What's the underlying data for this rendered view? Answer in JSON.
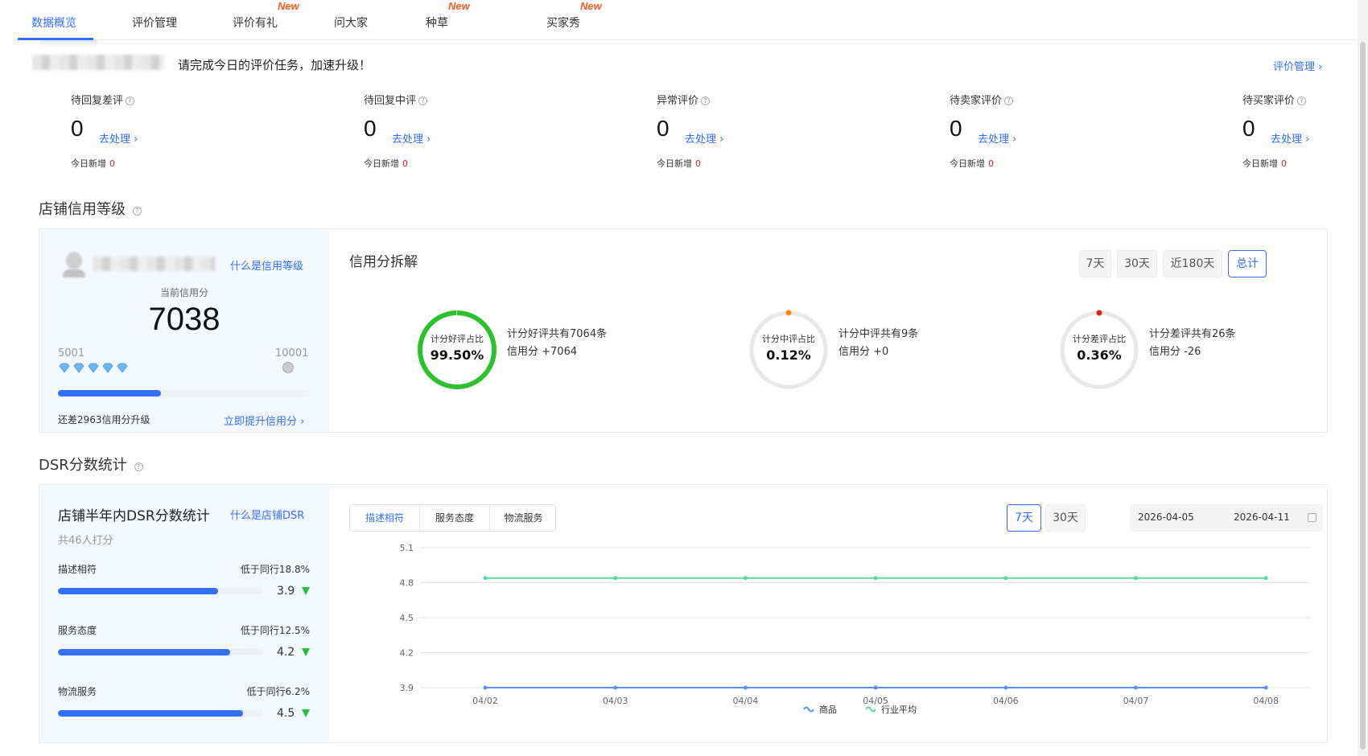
{
  "tabs": [
    {
      "label": "数据概览",
      "new": ""
    },
    {
      "label": "评价管理",
      "new": ""
    },
    {
      "label": "评价有礼",
      "new": "New"
    },
    {
      "label": "问大家",
      "new": ""
    },
    {
      "label": "种草",
      "new": "New"
    },
    {
      "label": "买家秀",
      "new": "New"
    }
  ],
  "notice": {
    "text": "请完成今日的评价任务，加速升级！",
    "manage_link": "评价管理 ›"
  },
  "stats": [
    {
      "label": "待回复差评",
      "value": "0",
      "action": "去处理 ›",
      "new_label": "今日新增",
      "new_value": "0"
    },
    {
      "label": "待回复中评",
      "value": "0",
      "action": "去处理 ›",
      "new_label": "今日新增",
      "new_value": "0"
    },
    {
      "label": "异常评价",
      "value": "0",
      "action": "去处理 ›",
      "new_label": "今日新增",
      "new_value": "0"
    },
    {
      "label": "待卖家评价",
      "value": "0",
      "action": "去处理 ›",
      "new_label": "今日新增",
      "new_value": "0"
    },
    {
      "label": "待买家评价",
      "value": "0",
      "action": "去处理 ›",
      "new_label": "今日新增",
      "new_value": "0"
    }
  ],
  "credit": {
    "section_title": "店铺信用等级",
    "what_link": "什么是信用等级",
    "current_label": "当前信用分",
    "score": "7038",
    "min": "5001",
    "max": "10001",
    "progress": 0.41,
    "gap_text": "还差2963信用分升级",
    "upgrade_link": "立即提升信用分 ›"
  },
  "breakdown": {
    "title": "信用分拆解",
    "ranges": [
      "7天",
      "30天",
      "近180天",
      "总计"
    ],
    "active_range": 3,
    "rings": [
      {
        "title": "计分好评占比",
        "pct": "99.50%",
        "fraction": 0.995,
        "color": "#2ec12e",
        "line1": "计分好评共有7064条",
        "line2": "信用分 +7064"
      },
      {
        "title": "计分中评占比",
        "pct": "0.12%",
        "fraction": 0.0012,
        "color": "#ff8a00",
        "line1": "计分中评共有9条",
        "line2": "信用分 +0"
      },
      {
        "title": "计分差评占比",
        "pct": "0.36%",
        "fraction": 0.0036,
        "color": "#e02020",
        "line1": "计分差评共有26条",
        "line2": "信用分 -26"
      }
    ]
  },
  "dsr": {
    "section_title": "DSR分数统计",
    "card_title": "店铺半年内DSR分数统计",
    "what_link": "什么是店铺DSR",
    "count_text": "共46人打分",
    "items": [
      {
        "label": "描述相符",
        "compare": "低于同行18.8%",
        "score": "3.9",
        "fraction": 0.78
      },
      {
        "label": "服务态度",
        "compare": "低于同行12.5%",
        "score": "4.2",
        "fraction": 0.84
      },
      {
        "label": "物流服务",
        "compare": "低于同行6.2%",
        "score": "4.5",
        "fraction": 0.9
      }
    ],
    "seg_tabs": [
      "描述相符",
      "服务态度",
      "物流服务"
    ],
    "active_seg": 0,
    "ranges": [
      "7天",
      "30天"
    ],
    "active_range": 0,
    "date_start": "2026-04-05",
    "date_end": "2026-04-11"
  },
  "chart_data": {
    "type": "line",
    "x": [
      "04/02",
      "04/03",
      "04/04",
      "04/05",
      "04/06",
      "04/07",
      "04/08"
    ],
    "yticks": [
      5.1,
      4.8,
      4.5,
      4.2,
      3.9
    ],
    "ylim": [
      3.9,
      5.1
    ],
    "series": [
      {
        "name": "商品",
        "color": "#5b8ff9",
        "values": [
          3.9,
          3.9,
          3.9,
          3.9,
          3.9,
          3.9,
          3.9
        ]
      },
      {
        "name": "行业平均",
        "color": "#5ad8a6",
        "values": [
          4.84,
          4.84,
          4.84,
          4.84,
          4.84,
          4.84,
          4.84
        ]
      }
    ],
    "grid": true,
    "legend": "bottom"
  }
}
